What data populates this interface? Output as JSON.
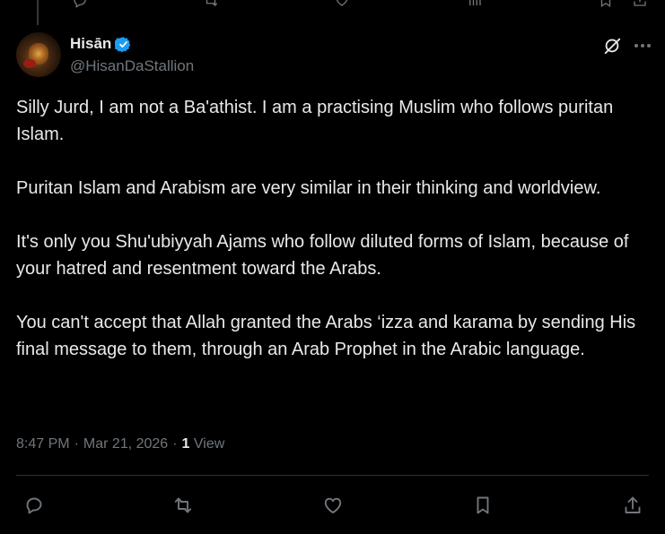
{
  "post": {
    "author": {
      "display_name": "Hisān",
      "handle": "@HisanDaStallion",
      "verified": true
    },
    "paragraphs": [
      "Silly Jurd, I am not a Ba'athist. I am a practising Muslim who follows puritan Islam.",
      "Puritan Islam and Arabism are very similar in their thinking and worldview.",
      "It's only you Shu'ubiyyah Ajams who follow diluted forms of Islam, because of your hatred and resentment toward the Arabs.",
      "You can't accept that Allah granted the Arabs ‘izza and karama by sending His final message to them, through an Arab Prophet in the Arabic language."
    ],
    "time": "8:47 PM",
    "separator": "·",
    "date": "Mar 21, 2026",
    "views_count": "1",
    "views_label": "View"
  },
  "icons": {
    "verified": "verified-badge-icon",
    "grok": "grok-icon",
    "more": "more-icon",
    "reply": "reply-icon",
    "repost": "repost-icon",
    "like": "like-icon",
    "bookmark": "bookmark-icon",
    "share": "share-icon"
  },
  "colors": {
    "background": "#000000",
    "text": "#e7e9ea",
    "muted": "#71767b",
    "verified": "#1d9bf0",
    "divider": "#2f3336"
  }
}
